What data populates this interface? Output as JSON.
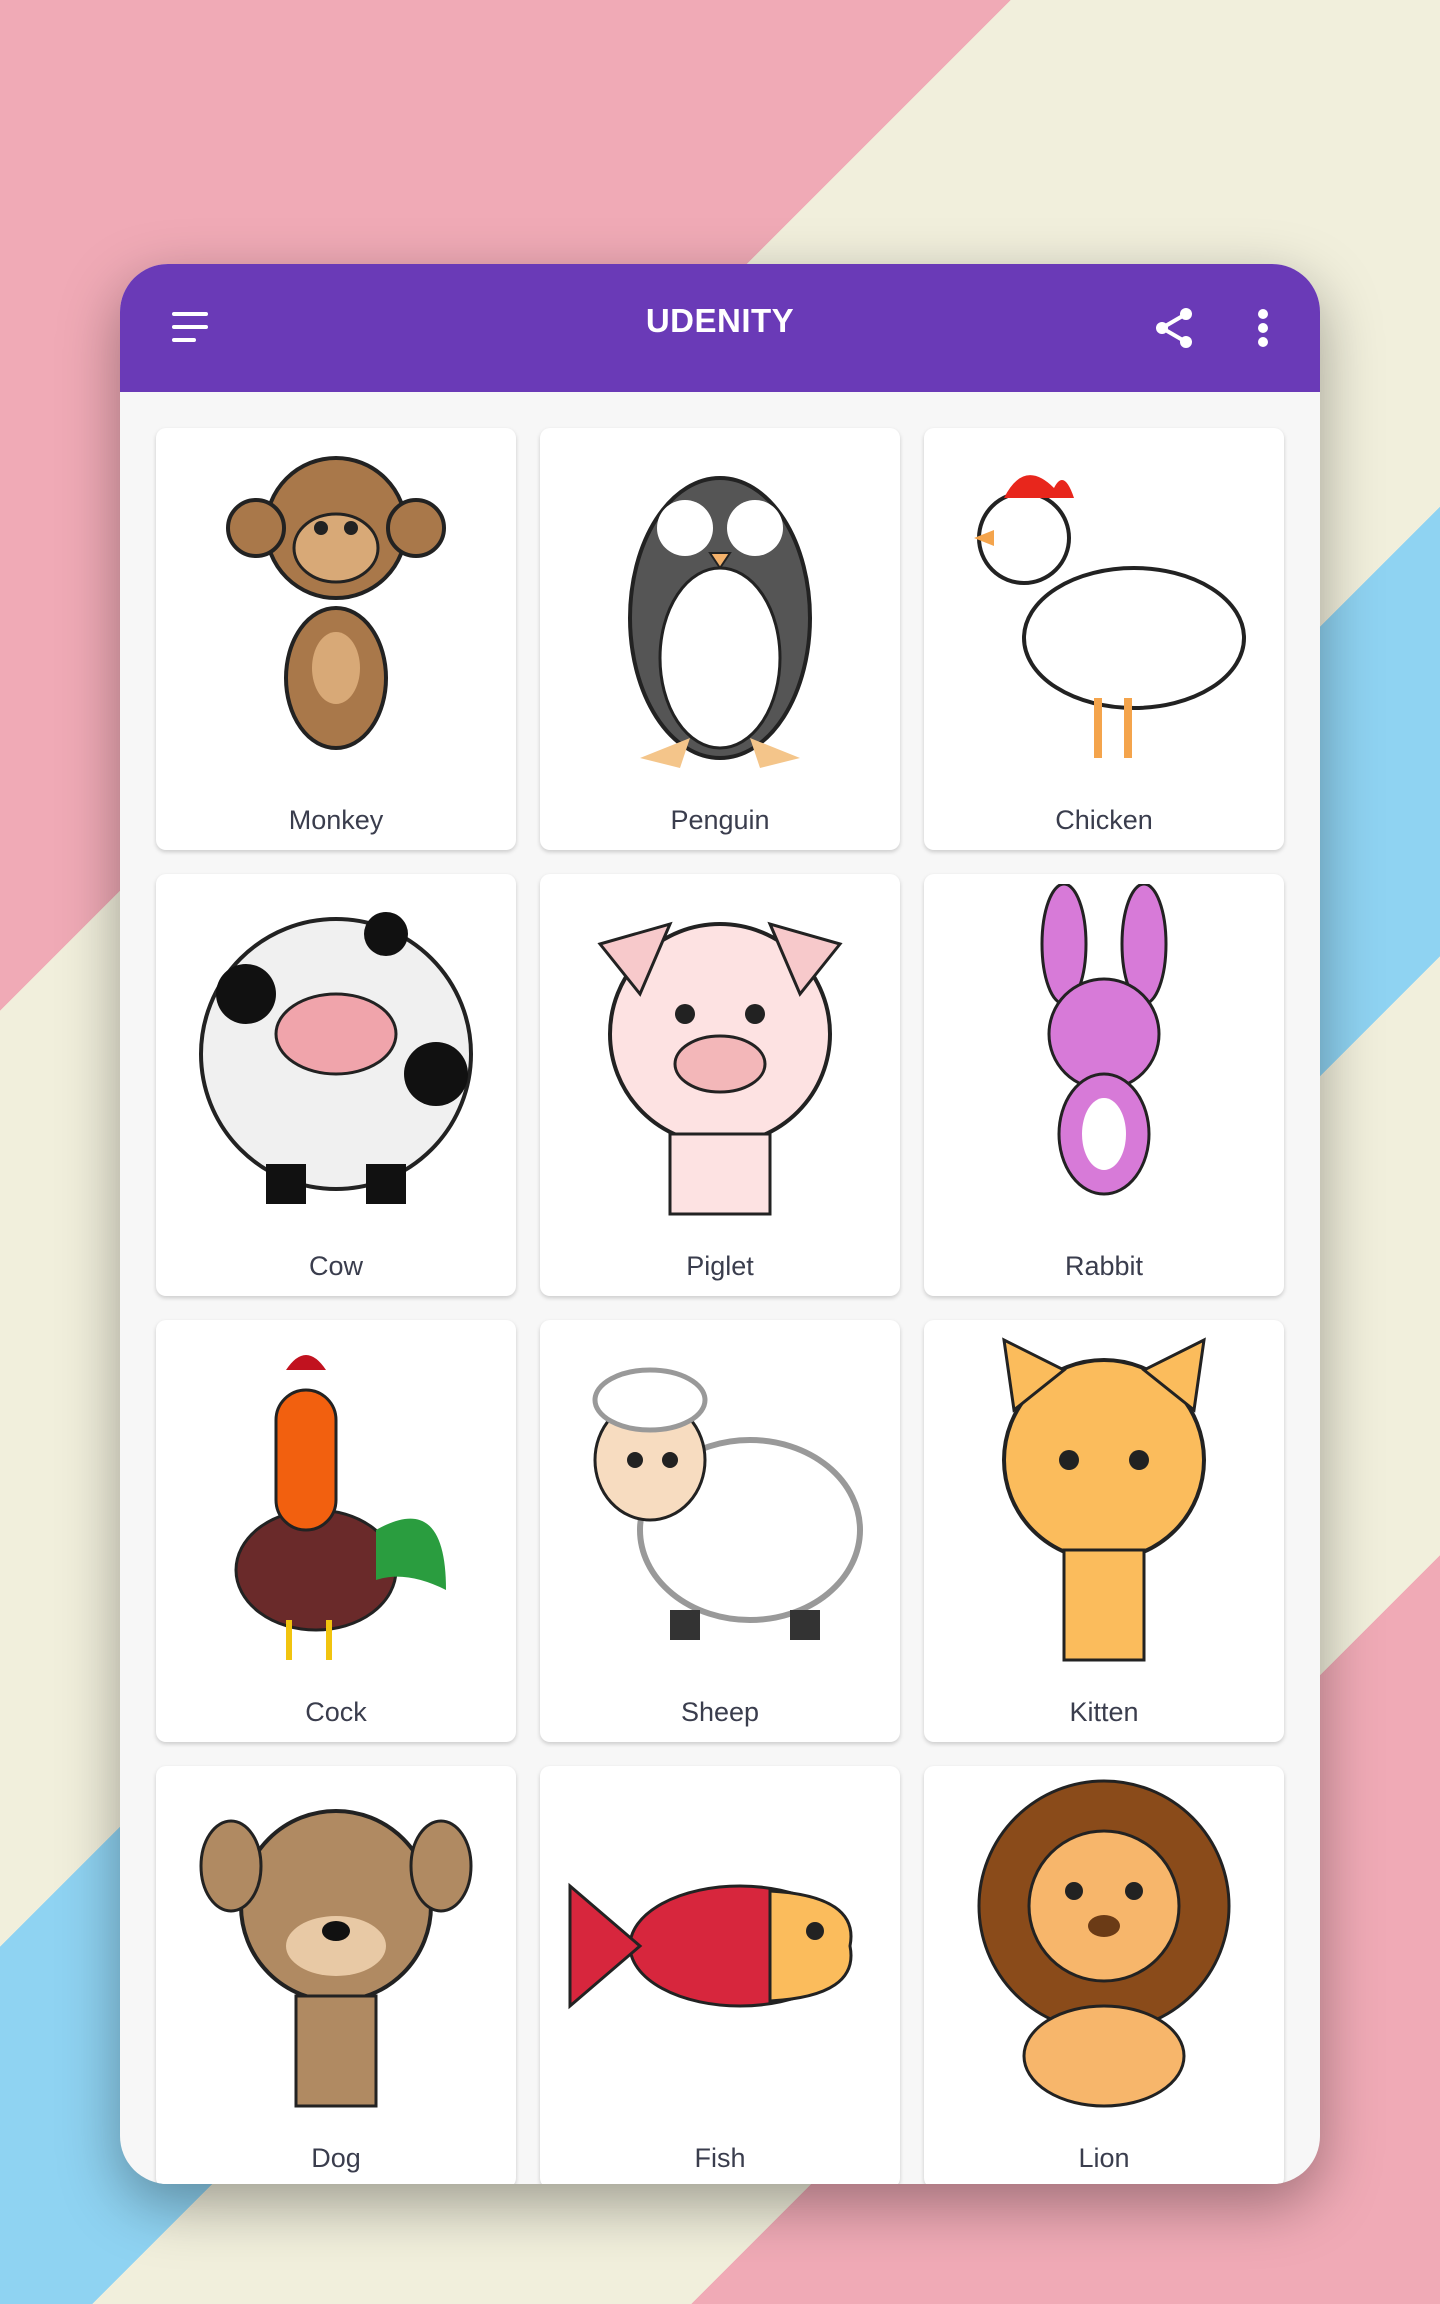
{
  "app": {
    "title": "UDENITY",
    "accent_color": "#6a3ab7"
  },
  "toolbar": {
    "menu_icon": "hamburger-menu-icon",
    "share_icon": "share-icon",
    "more_icon": "more-vert-icon"
  },
  "animals": [
    {
      "label": "Monkey",
      "icon": "monkey-illustration"
    },
    {
      "label": "Penguin",
      "icon": "penguin-illustration"
    },
    {
      "label": "Chicken",
      "icon": "chicken-illustration"
    },
    {
      "label": "Cow",
      "icon": "cow-illustration"
    },
    {
      "label": "Piglet",
      "icon": "piglet-illustration"
    },
    {
      "label": "Rabbit",
      "icon": "rabbit-illustration"
    },
    {
      "label": "Cock",
      "icon": "cock-illustration"
    },
    {
      "label": "Sheep",
      "icon": "sheep-illustration"
    },
    {
      "label": "Kitten",
      "icon": "kitten-illustration"
    },
    {
      "label": "Dog",
      "icon": "dog-illustration"
    },
    {
      "label": "Fish",
      "icon": "fish-illustration"
    },
    {
      "label": "Lion",
      "icon": "lion-illustration"
    }
  ]
}
